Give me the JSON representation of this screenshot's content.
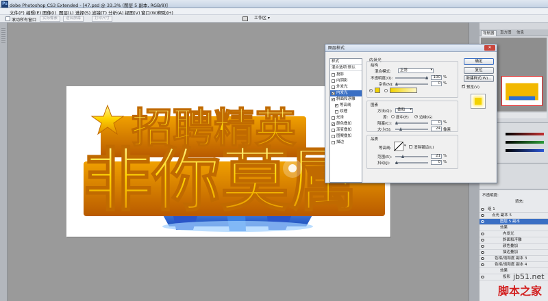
{
  "app": {
    "title": "Adobe Photoshop CS3 Extended - [47.psd @ 33.3% (图层 5 副本, RGB/8)]",
    "title_visible": "dobe Photoshop CS3 Extended - [47.psd @ 33.3% (图层 5 副本, RGB/8)]"
  },
  "menu": [
    "文件(F)",
    "编辑(E)",
    "图像(I)",
    "图层(L)",
    "选择(S)",
    "滤镜(T)",
    "分析(A)",
    "视图(V)",
    "窗口(W)",
    "帮助(H)"
  ],
  "options_bar": {
    "scroll_all_label": "滚动所有窗口",
    "actual_pixels": "实际像素",
    "fit_screen": "适合屏幕",
    "print_size": "打印尺寸",
    "workspace": "工作区 ▾"
  },
  "artwork": {
    "line1": "招聘精英",
    "line2": "非你莫属",
    "colors": {
      "gold": "#f7c600",
      "orange": "#e07a00",
      "blue": "#2a6fd6"
    }
  },
  "panels": {
    "top_tabs": [
      "导航器",
      "直方图",
      "信息"
    ],
    "layers": [
      {
        "name": "组 1"
      },
      {
        "name": "点光 副本 5"
      },
      {
        "name": "图层 5 副本",
        "selected": true
      },
      {
        "name": "效果"
      },
      {
        "name": "内发光"
      },
      {
        "name": "斜面和浮雕"
      },
      {
        "name": "颜色叠加"
      },
      {
        "name": "描边叠加"
      },
      {
        "name": "色相/饱和度 副本 3"
      },
      {
        "name": "色相/饱和度 副本 4"
      },
      {
        "name": "效果"
      },
      {
        "name": "投影"
      }
    ],
    "layer_controls": {
      "opacity_label": "不透明度:",
      "fill_label": "填充:"
    },
    "slider_colors": [
      "#c23232",
      "#2d9c3a",
      "#2a55d6"
    ]
  },
  "dialog": {
    "title": "图层样式",
    "close": "✕",
    "style_heads": [
      "样式",
      "混合选项:默认"
    ],
    "styles": [
      {
        "label": "投影",
        "checked": false,
        "indent": false
      },
      {
        "label": "内阴影",
        "checked": false,
        "indent": false
      },
      {
        "label": "外发光",
        "checked": false,
        "indent": false
      },
      {
        "label": "内发光",
        "checked": true,
        "indent": false,
        "active": true
      },
      {
        "label": "斜面和浮雕",
        "checked": true,
        "indent": false
      },
      {
        "label": "等高线",
        "checked": true,
        "indent": true
      },
      {
        "label": "纹理",
        "checked": false,
        "indent": true
      },
      {
        "label": "光泽",
        "checked": false,
        "indent": false
      },
      {
        "label": "颜色叠加",
        "checked": true,
        "indent": false
      },
      {
        "label": "渐变叠加",
        "checked": false,
        "indent": false
      },
      {
        "label": "图案叠加",
        "checked": false,
        "indent": false
      },
      {
        "label": "描边",
        "checked": false,
        "indent": false
      }
    ],
    "section": "内发光",
    "structure": {
      "title": "结构",
      "blend_mode_label": "混合模式:",
      "blend_mode": "正常",
      "opacity_label": "不透明度(O):",
      "opacity": "100",
      "noise_label": "杂色(N):",
      "noise": "0",
      "percent": "%"
    },
    "elements": {
      "title": "图素",
      "method_label": "方法(Q):",
      "method": "柔和",
      "source_label": "源:",
      "center_label": "居中(E)",
      "edge_label": "边缘(G)",
      "choke_label": "阻塞(C):",
      "choke": "0",
      "size_label": "大小(S):",
      "size": "24",
      "px": "像素",
      "percent": "%"
    },
    "quality": {
      "title": "品质",
      "contour_label": "等高线:",
      "antialias_label": "消除锯齿(L)",
      "range_label": "范围(R):",
      "range": "21",
      "jitter_label": "抖动(J):",
      "jitter": "0",
      "percent": "%"
    },
    "buttons": {
      "ok": "确定",
      "reset": "复位",
      "new_style": "新建样式(W)...",
      "preview": "预览(V)"
    },
    "glow_color": "#f2d200"
  },
  "watermark": {
    "url": "jb51.net",
    "site": "脚本之家"
  }
}
